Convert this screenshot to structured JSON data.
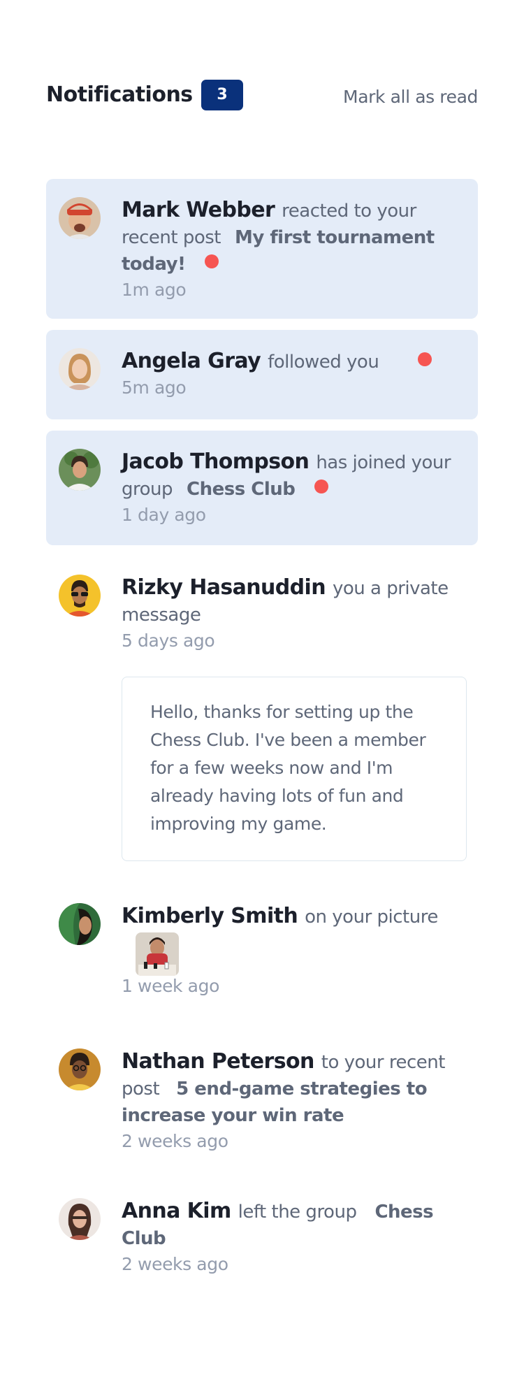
{
  "header": {
    "title": "Notifications",
    "count": "3",
    "mark_all": "Mark all as read"
  },
  "notifications": [
    {
      "name": "Mark Webber",
      "action": "reacted to your recent post",
      "target": "My first tournament today!",
      "time": "1m ago",
      "unread": true,
      "avatar": "avatar-mark-webber"
    },
    {
      "name": "Angela Gray",
      "action": "followed you",
      "time": "5m ago",
      "unread": true,
      "avatar": "avatar-angela-gray"
    },
    {
      "name": "Jacob Thompson",
      "action": "has joined your group",
      "target": "Chess Club",
      "time": "1 day ago",
      "unread": true,
      "avatar": "avatar-jacob-thompson"
    },
    {
      "name": "Rizky Hasanuddin",
      "action": "you a private message",
      "time": "5 days ago",
      "unread": false,
      "avatar": "avatar-rizky-hasanuddin",
      "message": "Hello, thanks for setting up the Chess Club. I've been a member for a few weeks now and I'm already having lots of fun and improving my game."
    },
    {
      "name": "Kimberly Smith",
      "action": "on your picture",
      "time": "1 week ago",
      "unread": false,
      "avatar": "avatar-kimberly-smith",
      "picture": "chess-picture-thumbnail"
    },
    {
      "name": "Nathan Peterson",
      "action": "to your recent post",
      "target": "5 end-game strategies to increase your win rate",
      "time": "2 weeks ago",
      "unread": false,
      "avatar": "avatar-nathan-peterson"
    },
    {
      "name": "Anna Kim",
      "action": "left the group",
      "target": "Chess Club",
      "time": "2 weeks ago",
      "unread": false,
      "avatar": "avatar-anna-kim"
    }
  ],
  "colors": {
    "unread_bg": "#e4ecf8",
    "badge": "#0a317b",
    "unread_dot": "#f65552",
    "name": "#1c202b",
    "body_text": "#5e6778",
    "time": "#939cad"
  }
}
